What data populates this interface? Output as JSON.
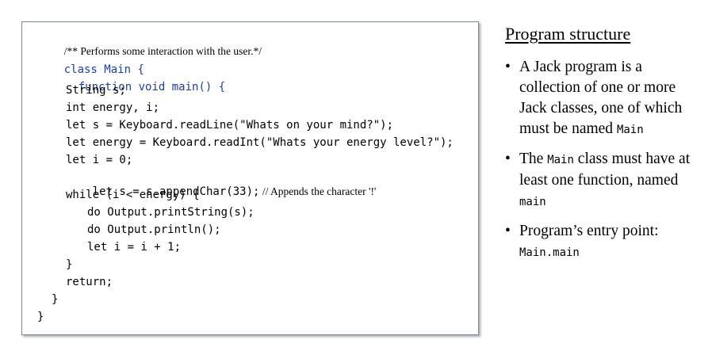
{
  "code": {
    "lines": [
      {
        "indent": 0,
        "text": "/** Performs some interaction with the user.*/",
        "kind": "comment"
      },
      {
        "indent": 0,
        "pre": "class",
        "text": " Main {",
        "kind": "keyword-line"
      },
      {
        "indent": 1,
        "pre": "function",
        "text": " void main() {",
        "kind": "keyword-line"
      },
      {
        "indent": 2,
        "text": "String s;"
      },
      {
        "indent": 2,
        "text": "int energy, i;"
      },
      {
        "indent": 2,
        "text": "let s = Keyboard.readLine(\"Whats on your mind?\");"
      },
      {
        "indent": 2,
        "text": "let energy = Keyboard.readInt(\"Whats your energy level?\");"
      },
      {
        "indent": 2,
        "text": "let i = 0;"
      },
      {
        "indent": 2,
        "text": "let s = s.appendChar(33);",
        "comment": " // Appends the character '!'"
      },
      {
        "indent": 2,
        "text": "while (i < energy) {"
      },
      {
        "indent": 3,
        "text": "do Output.printString(s);"
      },
      {
        "indent": 3,
        "text": "do Output.println();"
      },
      {
        "indent": 3,
        "text": "let i = i + 1;"
      },
      {
        "indent": 2,
        "text": "}"
      },
      {
        "indent": 2,
        "text": "return;"
      },
      {
        "indent": 1,
        "text": "}"
      },
      {
        "indent": 0,
        "text": "}"
      }
    ]
  },
  "sidebar": {
    "title": "Program structure",
    "bullets": [
      {
        "text_before": "A Jack program is a collection of one or more Jack classes, one of which must be named ",
        "code": "Main",
        "text_after": ""
      },
      {
        "text_before": "The ",
        "code": "Main",
        "text_middle": " class must have at least one function, named ",
        "code2": "main",
        "text_after": ""
      },
      {
        "text_before": "Program’s entry point: ",
        "code": "Main.main",
        "text_after": ""
      }
    ],
    "bullet_glyph": "•"
  },
  "colors": {
    "keyword": "#1f3f99",
    "box_border": "#7a8a9c"
  }
}
